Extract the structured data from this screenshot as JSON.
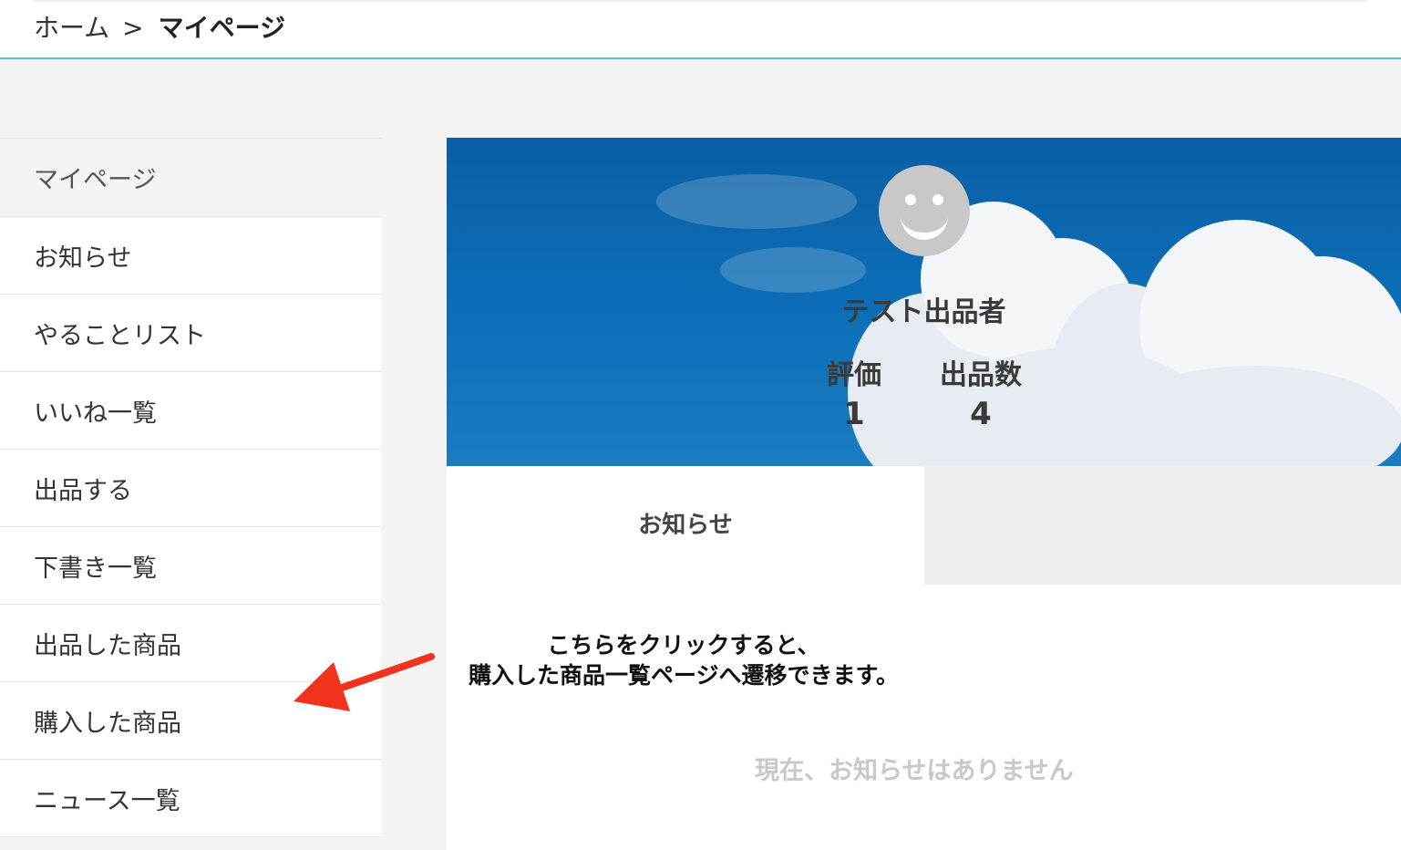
{
  "breadcrumb": {
    "home": "ホーム",
    "separator": ">",
    "current": "マイページ"
  },
  "sidebar": {
    "items": [
      {
        "label": "マイページ"
      },
      {
        "label": "お知らせ"
      },
      {
        "label": "やることリスト"
      },
      {
        "label": "いいね一覧"
      },
      {
        "label": "出品する"
      },
      {
        "label": "下書き一覧"
      },
      {
        "label": "出品した商品"
      },
      {
        "label": "購入した商品"
      },
      {
        "label": "ニュース一覧"
      }
    ]
  },
  "profile": {
    "name": "テスト出品者",
    "rating_label": "評価",
    "rating_value": "1",
    "listings_label": "出品数",
    "listings_value": "4",
    "avatar_icon": "smiley-avatar-icon"
  },
  "tabs": {
    "active_label": "お知らせ"
  },
  "annotation": {
    "line1": "こちらをクリックすると、",
    "line2": "購入した商品一覧ページへ遷移できます。",
    "arrow_color": "#f0331c"
  },
  "notices": {
    "empty_message": "現在、お知らせはありません"
  },
  "colors": {
    "accent": "#5bc3cf",
    "hero_sky": "#0d6fb8"
  }
}
